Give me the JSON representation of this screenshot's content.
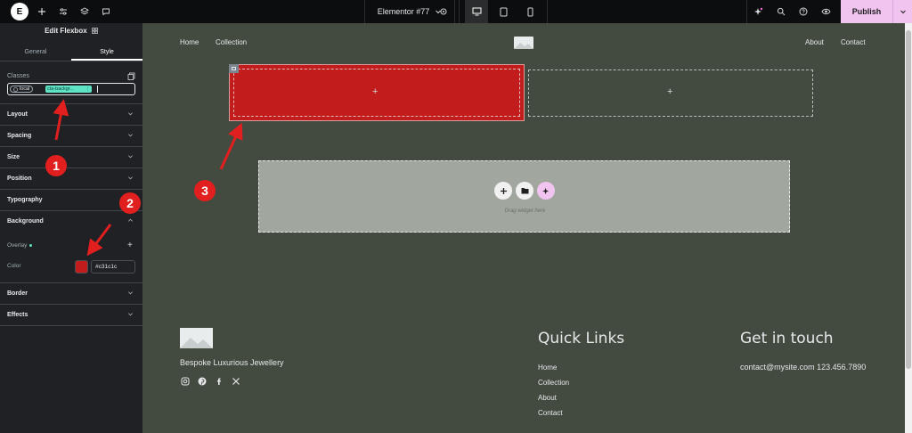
{
  "topbar": {
    "logo_letter": "E",
    "document_title": "Elementor #77",
    "publish_label": "Publish",
    "icons": [
      "elementor-logo-icon",
      "add-icon",
      "settings-sliders-icon",
      "layers-icon",
      "comments-icon",
      "settings-gear-icon",
      "desktop-icon",
      "tablet-icon",
      "mobile-icon",
      "ai-sparkle-icon",
      "search-icon",
      "help-icon",
      "preview-eye-icon",
      "chevron-down-icon"
    ]
  },
  "panel": {
    "title": "Edit Flexbox",
    "tabs": [
      {
        "label": "General",
        "active": false
      },
      {
        "label": "Style",
        "active": true
      }
    ],
    "classes": {
      "label": "Classes",
      "state_chip": "local",
      "class_chip": "cta-backgr..."
    },
    "sections": {
      "layout": "Layout",
      "spacing": "Spacing",
      "size": "Size",
      "position": "Position",
      "typography": "Typography",
      "background": "Background",
      "border": "Border",
      "effects": "Effects"
    },
    "background": {
      "overlay_label": "Overlay",
      "color_label": "Color",
      "color_value": "#c31c1c"
    }
  },
  "canvas": {
    "nav": {
      "left": [
        "Home",
        "Collection"
      ],
      "right": [
        "About",
        "Contact"
      ]
    },
    "drop_zone_text": "Drag widget here",
    "footer": {
      "tagline": "Bespoke Luxurious Jewellery",
      "quick_links_heading": "Quick Links",
      "quick_links": [
        "Home",
        "Collection",
        "About",
        "Contact"
      ],
      "contact_heading": "Get in touch",
      "contact_line": "contact@mysite.com 123.456.7890"
    }
  },
  "annotations": [
    "1",
    "2",
    "3"
  ],
  "colors": {
    "accent_red": "#c31c1c",
    "canvas_bg": "#434b40",
    "panel_bg": "#1f2124",
    "publish_bg": "#f1c4f0",
    "class_chip": "#5ee3c4",
    "annotation_red": "#e11f1f"
  }
}
